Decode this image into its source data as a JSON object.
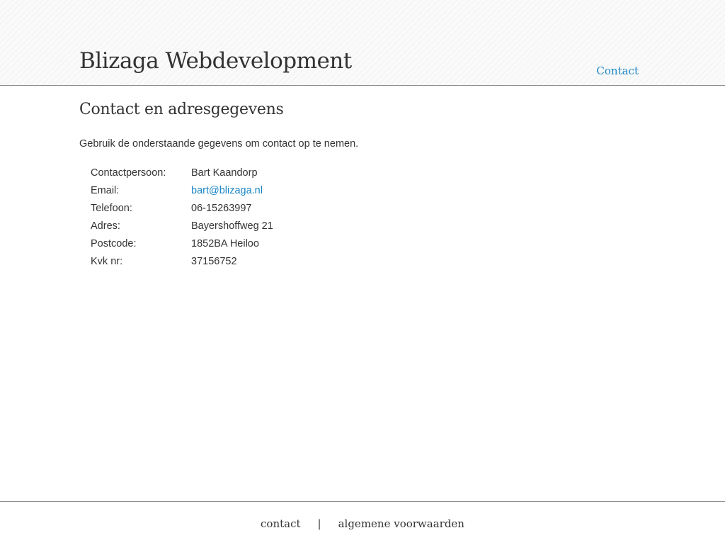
{
  "header": {
    "site_title": "Blizaga Webdevelopment",
    "nav": [
      {
        "label": "Contact"
      }
    ]
  },
  "main": {
    "page_title": "Contact en adresgegevens",
    "intro": "Gebruik de onderstaande gegevens om contact op te nemen.",
    "contact_rows": [
      {
        "label": "Contactpersoon:",
        "value": "Bart Kaandorp"
      },
      {
        "label": "Email:",
        "value": "bart@blizaga.nl"
      },
      {
        "label": "Telefoon:",
        "value": "06-15263997"
      },
      {
        "label": "Adres:",
        "value": "Bayershoffweg 21"
      },
      {
        "label": "Postcode:",
        "value": "1852BA Heiloo"
      },
      {
        "label": "Kvk nr:",
        "value": "37156752"
      }
    ]
  },
  "footer": {
    "links": [
      {
        "label": "contact"
      },
      {
        "label": "algemene voorwaarden"
      }
    ],
    "separator": "|"
  },
  "colors": {
    "link": "#1a86c7",
    "text": "#333333",
    "rule": "#8a8a8a"
  }
}
